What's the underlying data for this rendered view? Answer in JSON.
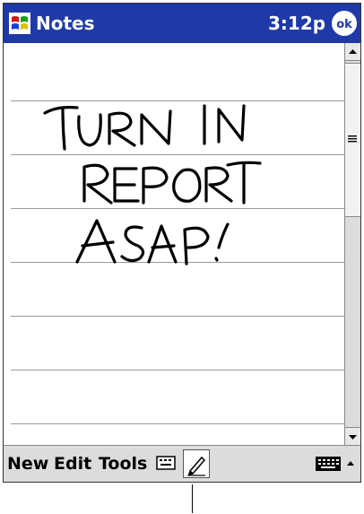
{
  "titlebar": {
    "app_title": "Notes",
    "time": "3:12p",
    "ok_label": "ok",
    "start_icon": "windows-flag-icon",
    "color": "#1f3aa8"
  },
  "note": {
    "handwriting_lines": [
      "TURN IN",
      "REPORT",
      "ASAP!"
    ]
  },
  "menubar": {
    "items": [
      "New",
      "Edit",
      "Tools"
    ],
    "icons": [
      "keyboard-icon",
      "pen-icon",
      "input-panel-icon",
      "up-arrow-icon"
    ]
  },
  "scrollbar": {
    "icons": [
      "up-arrow-icon",
      "down-arrow-icon",
      "grip-icon"
    ]
  }
}
